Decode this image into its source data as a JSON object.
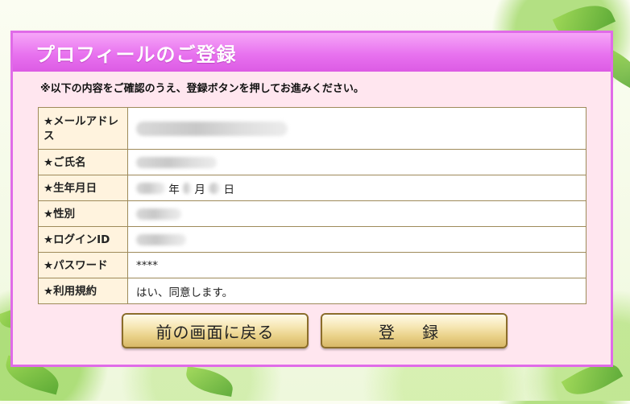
{
  "panel": {
    "title": "プロフィールのご登録",
    "notice": "※以下の内容をご確認のうえ、登録ボタンを押してお進みください。"
  },
  "form": {
    "rows": [
      {
        "label": "★メールアドレス",
        "value": ""
      },
      {
        "label": "★ご氏名",
        "value": ""
      },
      {
        "label": "★生年月日",
        "value": ""
      },
      {
        "label": "★性別",
        "value": ""
      },
      {
        "label": "★ログインID",
        "value": ""
      },
      {
        "label": "★パスワード",
        "value": "****"
      },
      {
        "label": "★利用規約",
        "value": "はい、同意します。"
      }
    ],
    "date_units": {
      "year": "年",
      "month": "月",
      "day": "日"
    }
  },
  "buttons": {
    "back": "前の画面に戻る",
    "submit": "登 録"
  },
  "colors": {
    "panel_border": "#e06be8",
    "panel_bg": "#ffe6ef",
    "label_bg": "#fff3de",
    "button_gold": "#e8cf85"
  }
}
